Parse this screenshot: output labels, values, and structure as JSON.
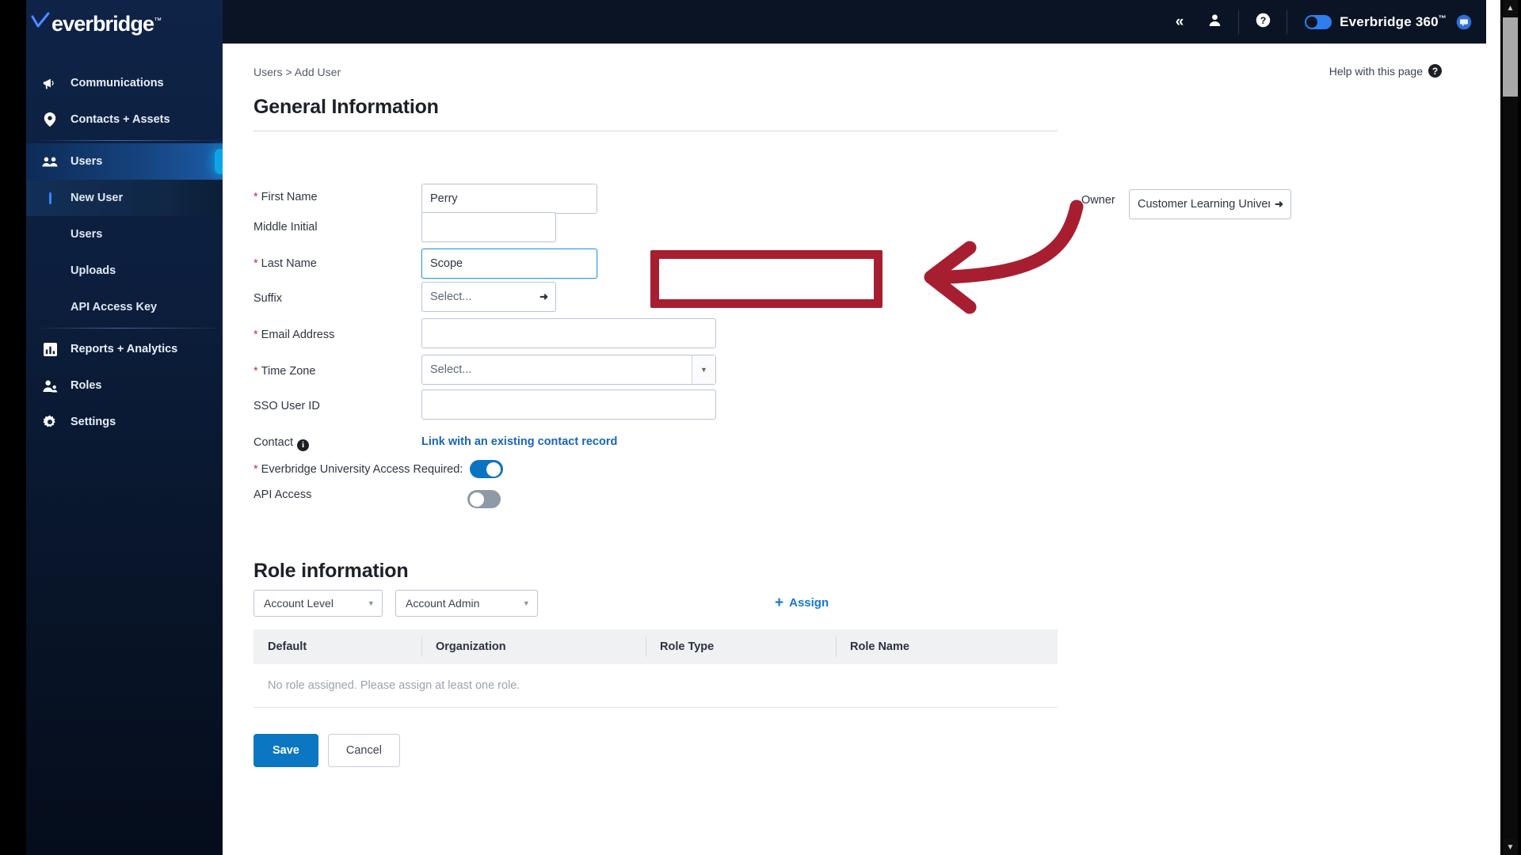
{
  "brand": {
    "logo_text": "everbridge",
    "logo_tm": "™",
    "product_name": "Everbridge 360",
    "product_tm": "™"
  },
  "topbar": {
    "collapse_icon": "chevron-double-left-icon",
    "user_icon": "user-icon",
    "help_icon": "question-circle-icon",
    "chat_icon": "chat-bubble-icon",
    "toggle_state": "on"
  },
  "sidebar": {
    "collapse_label": "«",
    "items": [
      {
        "label": "Communications",
        "icon": "megaphone-icon",
        "active": false
      },
      {
        "label": "Contacts + Assets",
        "icon": "map-pin-icon",
        "active": false
      },
      {
        "label": "Users",
        "icon": "users-group-icon",
        "active": true
      },
      {
        "label": "Reports + Analytics",
        "icon": "bar-chart-icon",
        "active": false
      },
      {
        "label": "Roles",
        "icon": "user-role-icon",
        "active": false
      },
      {
        "label": "Settings",
        "icon": "gear-icon",
        "active": false
      }
    ],
    "sub_items": [
      {
        "label": "New User",
        "current": true
      },
      {
        "label": "Users",
        "current": false
      },
      {
        "label": "Uploads",
        "current": false
      },
      {
        "label": "API Access Key",
        "current": false
      }
    ]
  },
  "page": {
    "breadcrumb": "Users > Add User",
    "help_link": "Help with this page",
    "help_icon": "question-circle-icon"
  },
  "general": {
    "title": "General Information",
    "fields": {
      "first_name": {
        "label": "First Name",
        "required": true,
        "value": "Perry",
        "placeholder": ""
      },
      "middle_initial": {
        "label": "Middle Initial",
        "required": false,
        "value": "",
        "placeholder": ""
      },
      "last_name": {
        "label": "Last Name",
        "required": true,
        "value": "Scope",
        "placeholder": "",
        "focused": true
      },
      "suffix": {
        "label": "Suffix",
        "required": false,
        "value": "Select..."
      },
      "email": {
        "label": "Email Address",
        "required": true,
        "value": "",
        "placeholder": ""
      },
      "time_zone": {
        "label": "Time Zone",
        "required": true,
        "value": "Select..."
      },
      "sso_user_id": {
        "label": "SSO User ID",
        "required": false,
        "value": "",
        "placeholder": ""
      },
      "contact": {
        "label": "Contact",
        "required": false,
        "link": "Link with an existing contact record",
        "info_icon": "info-icon"
      },
      "university_access": {
        "label": "Everbridge University Access Required:",
        "required": true,
        "state": "on"
      },
      "api_access": {
        "label": "API Access",
        "required": false,
        "state": "off"
      },
      "owner": {
        "label": "Owner",
        "value": "Customer Learning Universe"
      }
    }
  },
  "roles": {
    "title": "Role information",
    "level_select": "Account Level",
    "role_select": "Account Admin",
    "assign_label": "Assign",
    "assign_icon": "plus-icon",
    "columns": [
      "Default",
      "Organization",
      "Role Type",
      "Role Name"
    ],
    "empty_message": "No role assigned. Please assign at least one role.",
    "rows": []
  },
  "actions": {
    "save_label": "Save",
    "cancel_label": "Cancel"
  },
  "annotations": {
    "highlight_box_color": "#a81e31",
    "arrow_color": "#a81e31",
    "arrow_target": "last-name-field"
  }
}
